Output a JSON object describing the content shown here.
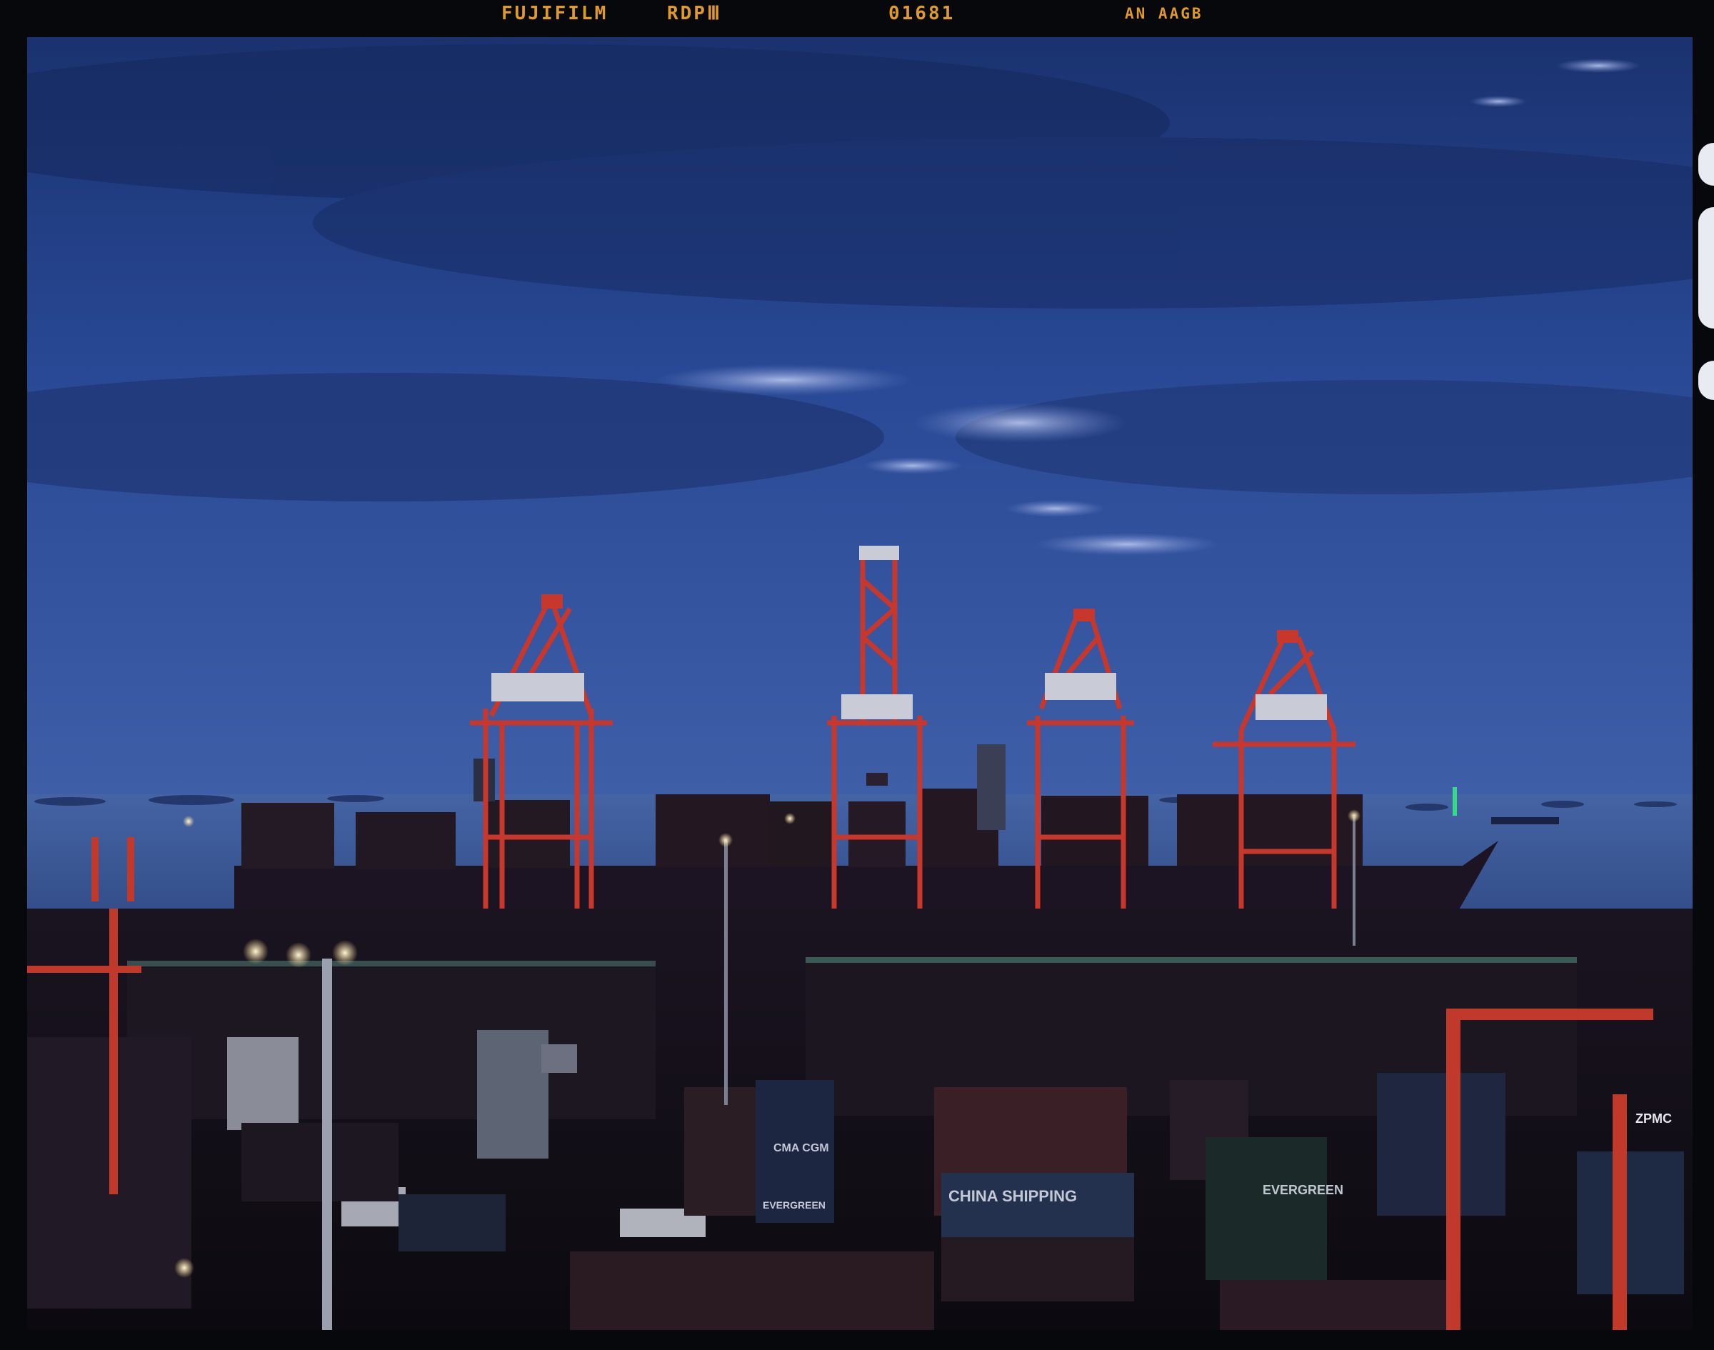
{
  "edge_print": {
    "brand": "FUJIFILM",
    "emulsion": "RDPⅢ",
    "frame_number": "01681",
    "code": "AN AAGB"
  },
  "photo": {
    "description_labels": {
      "container_1": "CHINA SHIPPING",
      "container_2": "EVERGREEN",
      "container_3": "CMA CGM",
      "container_4": "EVERGREEN",
      "crane_tag": "ZPMC"
    }
  },
  "colors": {
    "sky_top": "#1b3576",
    "sky_mid": "#2f4f9e",
    "sky_horizon": "#3d5ba6",
    "sea": "#3c5a96",
    "crane_red": "#c8372b",
    "yard_dark": "#120e16",
    "edge_print_orange": "#e09a2a"
  }
}
